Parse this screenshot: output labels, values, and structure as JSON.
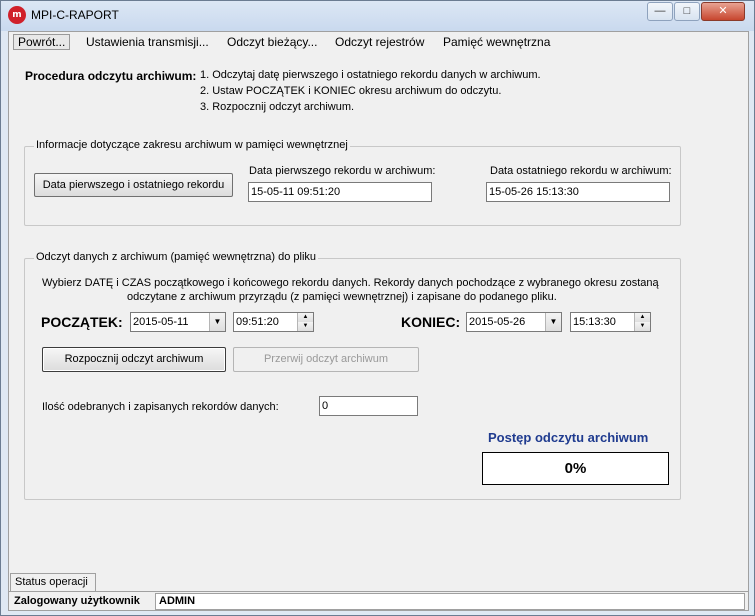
{
  "window": {
    "title": "MPI-C-RAPORT",
    "icon": "m-app-icon",
    "controls": {
      "minimize": "—",
      "maximize": "□",
      "close": "✕"
    }
  },
  "menu": [
    "Powrót...",
    "Ustawienia transmisji...",
    "Odczyt bieżący...",
    "Odczyt rejestrów",
    "Pamięć wewnętrzna"
  ],
  "procedure": {
    "label": "Procedura odczytu archiwum:",
    "steps": [
      "1. Odczytaj datę pierwszego i ostatniego rekordu danych w archiwum.",
      "2. Ustaw POCZĄTEK i KONIEC okresu archiwum do odczytu.",
      "3. Rozpocznij odczyt archiwum."
    ]
  },
  "range_group": {
    "legend": "Informacje dotyczące zakresu archiwum w pamięci wewnętrznej",
    "button": "Data pierwszego i ostatniego rekordu",
    "first_label": "Data pierwszego rekordu w archiwum:",
    "first_value": "15-05-11   09:51:20",
    "last_label": "Data ostatniego rekordu w archiwum:",
    "last_value": "15-05-26   15:13:30"
  },
  "read_group": {
    "legend": "Odczyt danych z archiwum (pamięć wewnętrzna) do pliku",
    "info_line1": "Wybierz DATĘ i CZAS początkowego i końcowego rekordu danych. Rekordy danych pochodzące z wybranego okresu zostaną",
    "info_line2": "odczytane z archiwum przyrządu (z pamięci wewnętrznej) i zapisane do podanego pliku.",
    "start_label": "POCZĄTEK:",
    "start_date": "2015-05-11",
    "start_time": "09:51:20",
    "end_label": "KONIEC:",
    "end_date": "2015-05-26",
    "end_time": "15:13:30",
    "start_button": "Rozpocznij odczyt archiwum",
    "stop_button": "Przerwij odczyt archiwum",
    "count_label": "Ilość odebranych i zapisanych rekordów danych:",
    "count_value": "0",
    "progress_title": "Postęp odczytu archiwum",
    "progress_value": "0%",
    "progress_fraction": 0
  },
  "status": {
    "tab": "Status operacji",
    "user_label": "Zalogowany użytkownik",
    "user_value": "ADMIN"
  }
}
